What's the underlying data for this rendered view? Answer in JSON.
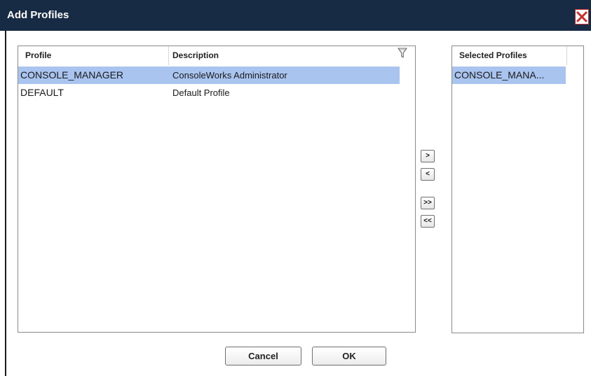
{
  "dialog": {
    "title": "Add Profiles",
    "close_icon": "close-icon"
  },
  "profiles_grid": {
    "columns": [
      "Profile",
      "Description"
    ],
    "filter_icon": "filter-icon",
    "rows": [
      {
        "profile": "CONSOLE_MANAGER",
        "description": "ConsoleWorks Administrator",
        "selected": true
      },
      {
        "profile": "DEFAULT",
        "description": "Default Profile",
        "selected": false
      }
    ]
  },
  "transfer": {
    "add_label": ">",
    "remove_label": "<",
    "add_all_label": ">>",
    "remove_all_label": "<<"
  },
  "selected_profiles": {
    "header": "Selected Profiles",
    "items": [
      "CONSOLE_MANA..."
    ]
  },
  "footer": {
    "cancel_label": "Cancel",
    "ok_label": "OK"
  },
  "colors": {
    "titlebar": "#172b45",
    "selection": "#a9c4ef",
    "close_accent": "#c9302c"
  }
}
